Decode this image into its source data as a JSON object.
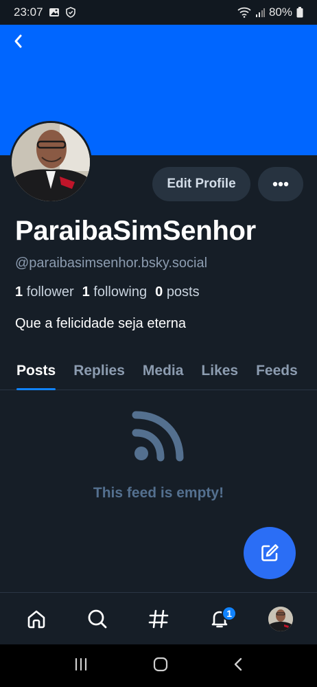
{
  "status_bar": {
    "time": "23:07",
    "battery": "80%",
    "icons": [
      "image-icon",
      "shield-icon",
      "wifi-icon",
      "signal-icon",
      "battery-icon"
    ]
  },
  "banner": {
    "color": "#0066ff"
  },
  "profile": {
    "display_name": "ParaibaSimSenhor",
    "handle": "@paraibasimsenhor.bsky.social",
    "stats": {
      "followers_count": "1",
      "followers_label": "follower",
      "following_count": "1",
      "following_label": "following",
      "posts_count": "0",
      "posts_label": "posts"
    },
    "bio": "Que a felicidade seja eterna",
    "edit_label": "Edit Profile"
  },
  "tabs": [
    {
      "label": "Posts",
      "active": true
    },
    {
      "label": "Replies",
      "active": false
    },
    {
      "label": "Media",
      "active": false
    },
    {
      "label": "Likes",
      "active": false
    },
    {
      "label": "Feeds",
      "active": false
    }
  ],
  "feed": {
    "empty_text": "This feed is empty!"
  },
  "bottom_nav": {
    "items": [
      "home-icon",
      "search-icon",
      "hashtag-icon",
      "notifications-icon",
      "profile-avatar"
    ],
    "notifications_badge": "1"
  },
  "colors": {
    "background": "#161e27",
    "accent": "#1083fe",
    "fab": "#2b6ef5",
    "muted_text": "#8c9cb0"
  }
}
